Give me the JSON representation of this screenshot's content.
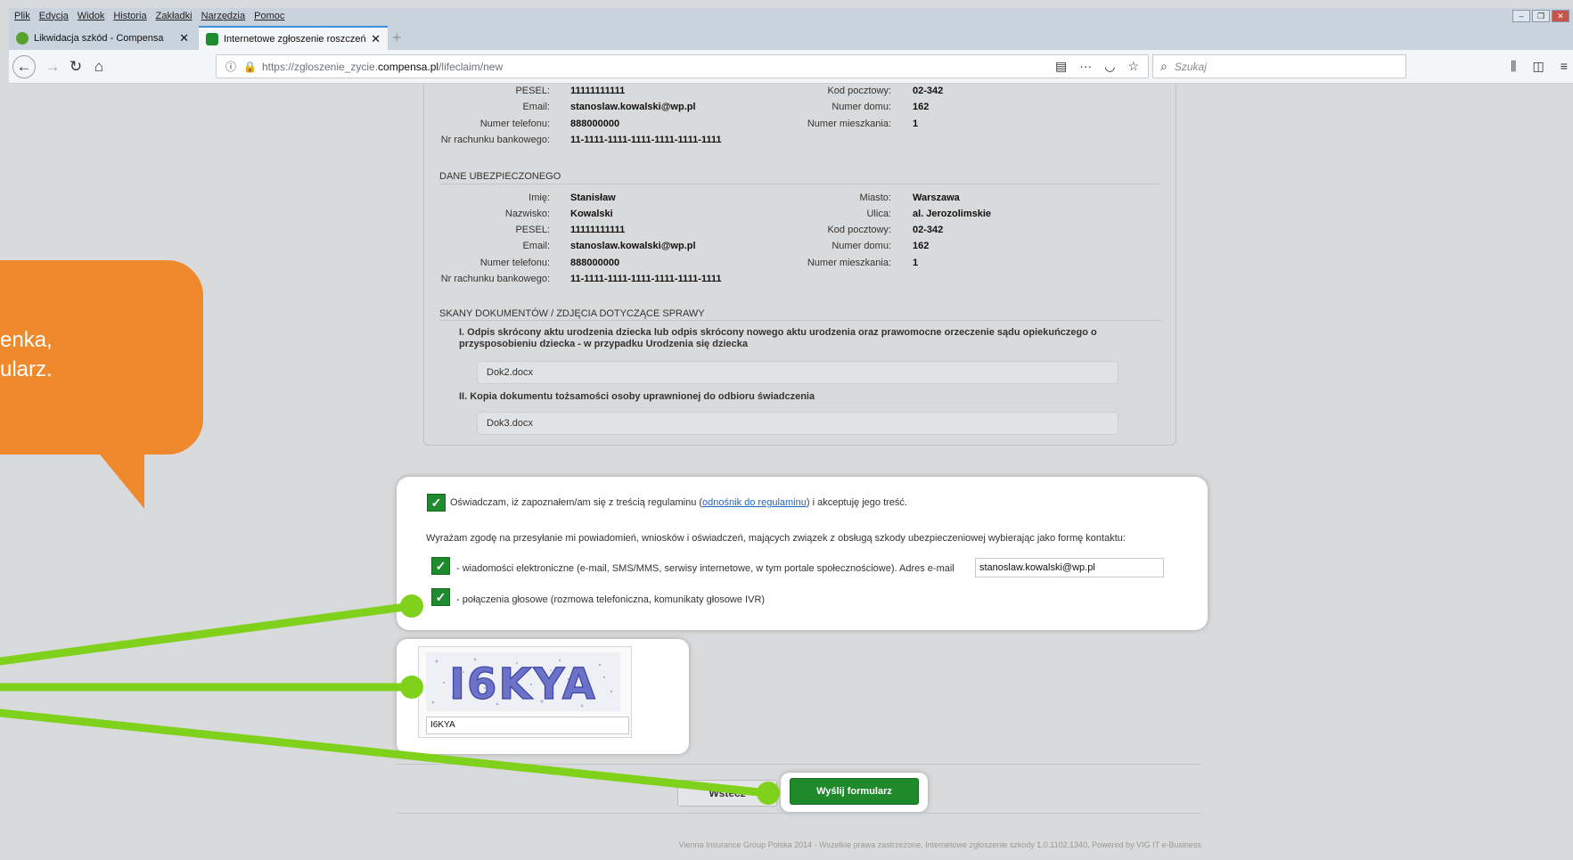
{
  "browser": {
    "menu": [
      "Plik",
      "Edycja",
      "Widok",
      "Historia",
      "Zakładki",
      "Narzędzia",
      "Pomoc"
    ],
    "tabs": [
      {
        "label": "Likwidacja szkód - Compensa",
        "close": "✕"
      },
      {
        "label": "Internetowe zgłoszenie roszczeń",
        "close": "✕"
      }
    ],
    "new_tab": "+",
    "url": {
      "prefix": "https://zgloszenie_zycie.",
      "host": "compensa.pl",
      "path": "/lifeclaim/new"
    },
    "search_placeholder": "Szukaj",
    "colors": {
      "active_tab_accent": "#3d8de0",
      "lock": "#1f9b35"
    }
  },
  "person_top": {
    "rows": [
      {
        "label": "PESEL:",
        "value": "11111111111"
      },
      {
        "label": "Email:",
        "value": "stanoslaw.kowalski@wp.pl"
      },
      {
        "label": "Numer telefonu:",
        "value": "888000000"
      },
      {
        "label": "Nr rachunku bankowego:",
        "value": "11-1111-1111-1111-1111-1111-1111"
      }
    ],
    "right_rows": [
      {
        "label": "Kod pocztowy:",
        "value": "02-342"
      },
      {
        "label": "Numer domu:",
        "value": "162"
      },
      {
        "label": "Numer mieszkania:",
        "value": "1"
      }
    ]
  },
  "insured": {
    "heading": "DANE UBEZPIECZONEGO",
    "rows": [
      {
        "label": "Imię:",
        "value": "Stanisław"
      },
      {
        "label": "Nazwisko:",
        "value": "Kowalski"
      },
      {
        "label": "PESEL:",
        "value": "11111111111"
      },
      {
        "label": "Email:",
        "value": "stanoslaw.kowalski@wp.pl"
      },
      {
        "label": "Numer telefonu:",
        "value": "888000000"
      },
      {
        "label": "Nr rachunku bankowego:",
        "value": "11-1111-1111-1111-1111-1111-1111"
      }
    ],
    "right_rows": [
      {
        "label": "Miasto:",
        "value": "Warszawa"
      },
      {
        "label": "Ulica:",
        "value": "al. Jerozolimskie"
      },
      {
        "label": "Kod pocztowy:",
        "value": "02-342"
      },
      {
        "label": "Numer domu:",
        "value": "162"
      },
      {
        "label": "Numer mieszkania:",
        "value": "1"
      }
    ]
  },
  "documents": {
    "heading": "SKANY DOKUMENTÓW / ZDJĘCIA DOTYCZĄCE SPRAWY",
    "items": [
      {
        "title": "I. Odpis skrócony aktu urodzenia dziecka lub odpis skrócony nowego aktu urodzenia oraz prawomocne orzeczenie sądu opiekuńczego o przysposobieniu dziecka - w przypadku Urodzenia się dziecka",
        "file": "Dok2.docx"
      },
      {
        "title": "II. Kopia dokumentu tożsamości osoby uprawnionej do odbioru świadczenia",
        "file": "Dok3.docx"
      }
    ]
  },
  "consent": {
    "terms_before": "Oświadczam, iż zapoznałem/am się z treścią regulaminu (",
    "terms_link": "odnośnik do regulaminu",
    "terms_after": ") i akceptuję jego treść.",
    "agree_text": "Wyrażam zgodę na przesyłanie mi powiadomień, wniosków i oświadczeń, mających związek z obsługą szkody ubezpieczeniowej wybierając jako formę kontaktu:",
    "electronic_text": "- wiadomości elektroniczne (e-mail, SMS/MMS, serwisy internetowe, w tym portale społecznościowe). Adres e-mail",
    "email_value": "stanoslaw.kowalski@wp.pl",
    "voice_text": "- połączenia głosowe (rozmowa telefoniczna, komunikaty głosowe IVR)",
    "check_mark": "✓",
    "check_color": "#1e8b2f"
  },
  "captcha": {
    "image_text": "I6KYA",
    "input_value": "I6KYA"
  },
  "actions": {
    "back": "Wstecz",
    "submit": "Wyślij formularz",
    "submit_color": "#1f8a2c"
  },
  "footer": "Vienna Insurance Group Polska 2014 - Wszelkie prawa zastrzeżone, Internetowe zgłoszenie szkody 1.0.1102.1340, Powered by VIG IT e-Business",
  "callout": {
    "lines": [
      "enka,",
      "ularz."
    ],
    "color": "#ee8a2b",
    "pointer_color": "#7fd11c"
  }
}
